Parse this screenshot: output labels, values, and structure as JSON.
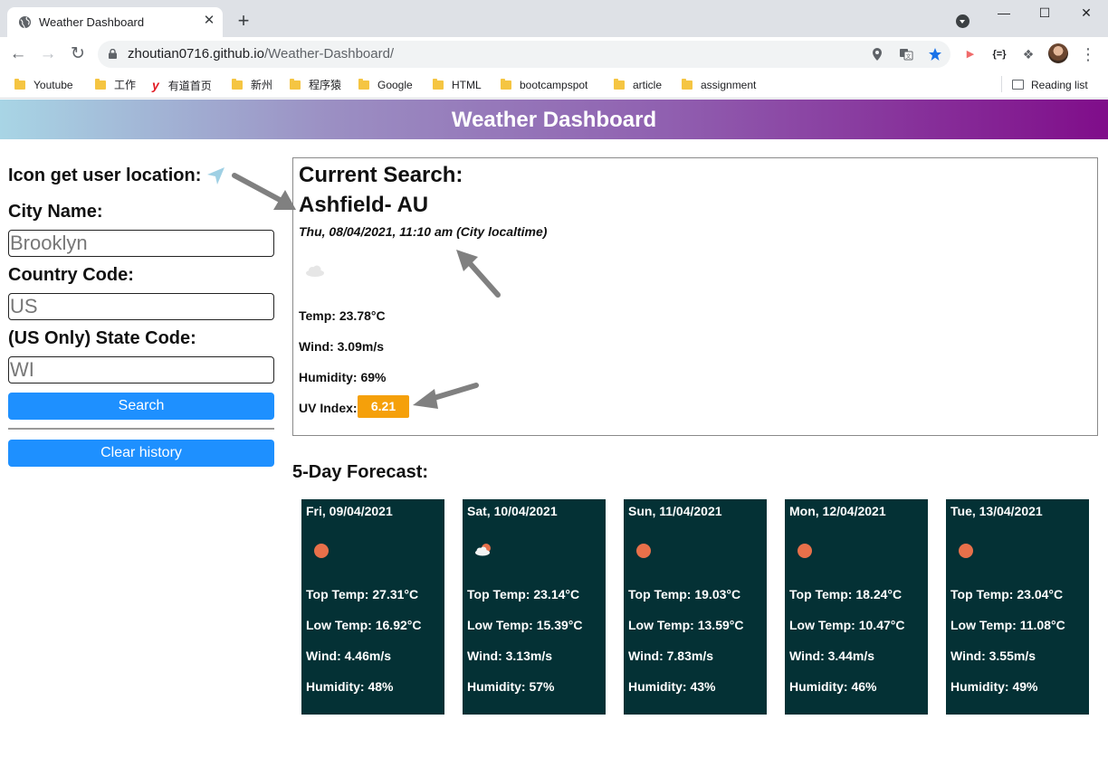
{
  "browser": {
    "tab_title": "Weather Dashboard",
    "tab_close": "✕",
    "new_tab": "+",
    "url_host": "zhoutian0716.github.io",
    "url_path": "/Weather-Dashboard/",
    "window_minimize": "—",
    "window_maximize": "☐",
    "window_close": "✕",
    "bookmarks": [
      "Youtube",
      "工作",
      "有道首页",
      "新州",
      "程序猿",
      "Google",
      "HTML",
      "bootcampspot",
      "article",
      "assignment"
    ],
    "reading_list": "Reading list"
  },
  "page": {
    "title": "Weather Dashboard"
  },
  "sidebar": {
    "location_label": "Icon get user location:",
    "city_label": "City Name:",
    "city_placeholder": "Brooklyn",
    "country_label": "Country Code:",
    "country_placeholder": "US",
    "state_label": "(US Only) State Code:",
    "state_placeholder": "WI",
    "search_button": "Search",
    "clear_button": "Clear history"
  },
  "current": {
    "heading": "Current Search:",
    "city": "Ashfield- AU",
    "datetime": "Thu, 08/04/2021, 11:10 am (City localtime)",
    "icon": "cloud-icon",
    "temp": "Temp: 23.78°C",
    "wind": "Wind: 3.09m/s",
    "humidity": "Humidity: 69%",
    "uv_label": "UV Index:",
    "uv_value": "6.21",
    "uv_color": "#f5a00a"
  },
  "forecast": {
    "heading": "5-Day Forecast:",
    "card_color": "#043135",
    "days": [
      {
        "date": "Fri, 09/04/2021",
        "icon": "sun-icon",
        "top": "Top Temp: 27.31°C",
        "low": "Low Temp: 16.92°C",
        "wind": "Wind: 4.46m/s",
        "humidity": "Humidity: 48%"
      },
      {
        "date": "Sat, 10/04/2021",
        "icon": "partly-cloudy-icon",
        "top": "Top Temp: 23.14°C",
        "low": "Low Temp: 15.39°C",
        "wind": "Wind: 3.13m/s",
        "humidity": "Humidity: 57%"
      },
      {
        "date": "Sun, 11/04/2021",
        "icon": "sun-icon",
        "top": "Top Temp: 19.03°C",
        "low": "Low Temp: 13.59°C",
        "wind": "Wind: 7.83m/s",
        "humidity": "Humidity: 43%"
      },
      {
        "date": "Mon, 12/04/2021",
        "icon": "sun-icon",
        "top": "Top Temp: 18.24°C",
        "low": "Low Temp: 10.47°C",
        "wind": "Wind: 3.44m/s",
        "humidity": "Humidity: 46%"
      },
      {
        "date": "Tue, 13/04/2021",
        "icon": "sun-icon",
        "top": "Top Temp: 23.04°C",
        "low": "Low Temp: 11.08°C",
        "wind": "Wind: 3.55m/s",
        "humidity": "Humidity: 49%"
      }
    ]
  },
  "colors": {
    "header_gradient": [
      "#a8d5e5",
      "#800d8a"
    ],
    "button_blue": "#1e90ff",
    "sun": "#e8704a"
  }
}
